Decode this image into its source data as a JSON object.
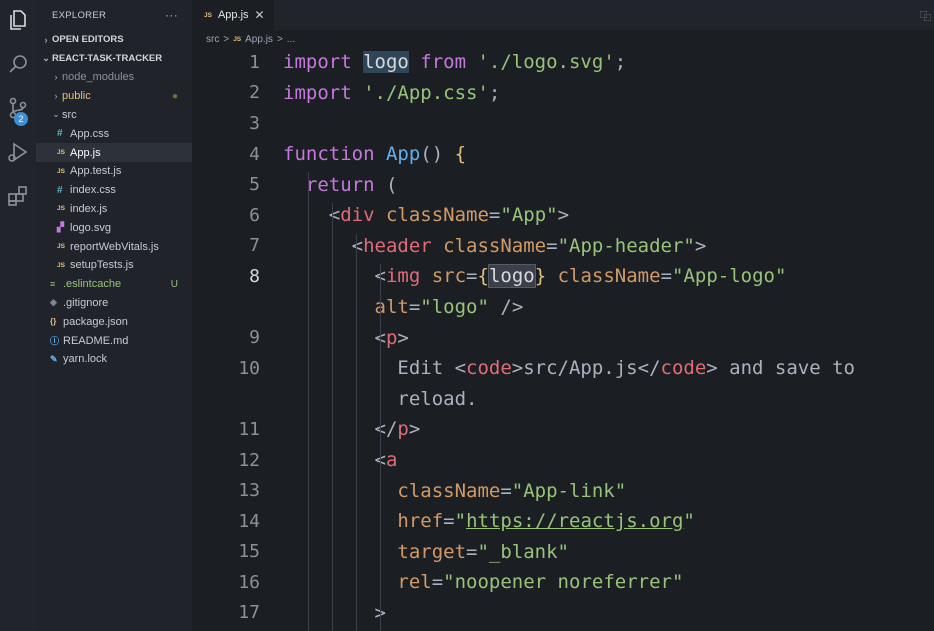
{
  "activity_bar": {
    "items": [
      {
        "name": "explorer-icon"
      },
      {
        "name": "search-icon"
      },
      {
        "name": "source-control-icon",
        "badge": "2"
      },
      {
        "name": "run-debug-icon"
      },
      {
        "name": "extensions-icon"
      }
    ]
  },
  "sidebar": {
    "title": "EXPLORER",
    "more": "···",
    "open_editors": "OPEN EDITORS",
    "project": "REACT-TASK-TRACKER",
    "tree": [
      {
        "label": "node_modules",
        "kind": "folder",
        "indent": 1,
        "chev": "›",
        "dim": true
      },
      {
        "label": "public",
        "kind": "folder",
        "indent": 1,
        "chev": "›",
        "color": "#e5c07b",
        "deco": "●"
      },
      {
        "label": "src",
        "kind": "folder",
        "indent": 1,
        "chev": "⌄"
      },
      {
        "label": "App.css",
        "kind": "css",
        "indent": 2
      },
      {
        "label": "App.js",
        "kind": "js",
        "indent": 2,
        "selected": true
      },
      {
        "label": "App.test.js",
        "kind": "js",
        "indent": 2
      },
      {
        "label": "index.css",
        "kind": "css",
        "indent": 2
      },
      {
        "label": "index.js",
        "kind": "js",
        "indent": 2
      },
      {
        "label": "logo.svg",
        "kind": "svg",
        "indent": 2
      },
      {
        "label": "reportWebVitals.js",
        "kind": "js",
        "indent": 2
      },
      {
        "label": "setupTests.js",
        "kind": "js",
        "indent": 2
      },
      {
        "label": ".eslintcache",
        "kind": "eslint",
        "indent": 1,
        "color": "#98c379",
        "deco": "U"
      },
      {
        "label": ".gitignore",
        "kind": "git",
        "indent": 1
      },
      {
        "label": "package.json",
        "kind": "json",
        "indent": 1
      },
      {
        "label": "README.md",
        "kind": "info",
        "indent": 1
      },
      {
        "label": "yarn.lock",
        "kind": "yarn",
        "indent": 1
      }
    ]
  },
  "tab": {
    "icon": "JS",
    "label": "App.js",
    "close": "✕"
  },
  "breadcrumb": {
    "folder": "src",
    "sep": ">",
    "icon": "JS",
    "file": "App.js",
    "tail": "..."
  },
  "colors": {
    "keyword": "#c678dd",
    "string": "#98c379",
    "function": "#61afef",
    "tag": "#e06c75",
    "attribute": "#d19a66",
    "background": "#1b1f24"
  },
  "code": {
    "lines": [
      {
        "num": "1",
        "segs": [
          [
            "kw",
            "import "
          ],
          [
            "hl",
            "logo"
          ],
          [
            "kw",
            " from "
          ],
          [
            "str",
            "'./logo.svg'"
          ],
          [
            "punc",
            ";"
          ]
        ]
      },
      {
        "num": "2",
        "segs": [
          [
            "kw",
            "import "
          ],
          [
            "str",
            "'./App.css'"
          ],
          [
            "punc",
            ";"
          ]
        ]
      },
      {
        "num": "3",
        "segs": []
      },
      {
        "num": "4",
        "segs": [
          [
            "kw",
            "function "
          ],
          [
            "fn",
            "App"
          ],
          [
            "punc",
            "() "
          ],
          [
            "brace",
            "{"
          ]
        ]
      },
      {
        "num": "5",
        "segs": [
          [
            "kw",
            "  return "
          ],
          [
            "punc",
            "("
          ]
        ]
      },
      {
        "num": "6",
        "segs": [
          [
            "punc",
            "    <"
          ],
          [
            "tag",
            "div"
          ],
          [
            "attr",
            " className"
          ],
          [
            "punc",
            "="
          ],
          [
            "str",
            "\"App\""
          ],
          [
            "punc",
            ">"
          ]
        ]
      },
      {
        "num": "7",
        "segs": [
          [
            "punc",
            "      <"
          ],
          [
            "tag",
            "header"
          ],
          [
            "attr",
            " className"
          ],
          [
            "punc",
            "="
          ],
          [
            "str",
            "\"App-header\""
          ],
          [
            "punc",
            ">"
          ]
        ]
      },
      {
        "num": "8",
        "segs": [
          [
            "punc",
            "        <"
          ],
          [
            "tag",
            "img"
          ],
          [
            "attr",
            " src"
          ],
          [
            "punc",
            "="
          ],
          [
            "brace",
            "{"
          ],
          [
            "hl2",
            "logo"
          ],
          [
            "brace",
            "}"
          ],
          [
            "attr",
            " className"
          ],
          [
            "punc",
            "="
          ],
          [
            "str",
            "\"App-logo\""
          ]
        ],
        "active": true
      },
      {
        "num": "",
        "segs": [
          [
            "attr",
            "        alt"
          ],
          [
            "punc",
            "="
          ],
          [
            "str",
            "\"logo\""
          ],
          [
            "punc",
            " />"
          ]
        ]
      },
      {
        "num": "9",
        "segs": [
          [
            "punc",
            "        <"
          ],
          [
            "tag",
            "p"
          ],
          [
            "punc",
            ">"
          ]
        ]
      },
      {
        "num": "10",
        "segs": [
          [
            "punc",
            "          Edit <"
          ],
          [
            "tag",
            "code"
          ],
          [
            "punc",
            ">src/App.js</"
          ],
          [
            "tag",
            "code"
          ],
          [
            "punc",
            "> and save to"
          ]
        ]
      },
      {
        "num": "",
        "segs": [
          [
            "punc",
            "          reload."
          ]
        ]
      },
      {
        "num": "11",
        "segs": [
          [
            "punc",
            "        </"
          ],
          [
            "tag",
            "p"
          ],
          [
            "punc",
            ">"
          ]
        ]
      },
      {
        "num": "12",
        "segs": [
          [
            "punc",
            "        <"
          ],
          [
            "tag",
            "a"
          ]
        ]
      },
      {
        "num": "13",
        "segs": [
          [
            "attr",
            "          className"
          ],
          [
            "punc",
            "="
          ],
          [
            "str",
            "\"App-link\""
          ]
        ]
      },
      {
        "num": "14",
        "segs": [
          [
            "attr",
            "          href"
          ],
          [
            "punc",
            "="
          ],
          [
            "str",
            "\""
          ],
          [
            "url",
            "https://reactjs.org"
          ],
          [
            "str",
            "\""
          ]
        ]
      },
      {
        "num": "15",
        "segs": [
          [
            "attr",
            "          target"
          ],
          [
            "punc",
            "="
          ],
          [
            "str",
            "\"_blank\""
          ]
        ]
      },
      {
        "num": "16",
        "segs": [
          [
            "attr",
            "          rel"
          ],
          [
            "punc",
            "="
          ],
          [
            "str",
            "\"noopener noreferrer\""
          ]
        ]
      },
      {
        "num": "17",
        "segs": [
          [
            "punc",
            "        >"
          ]
        ]
      }
    ]
  }
}
